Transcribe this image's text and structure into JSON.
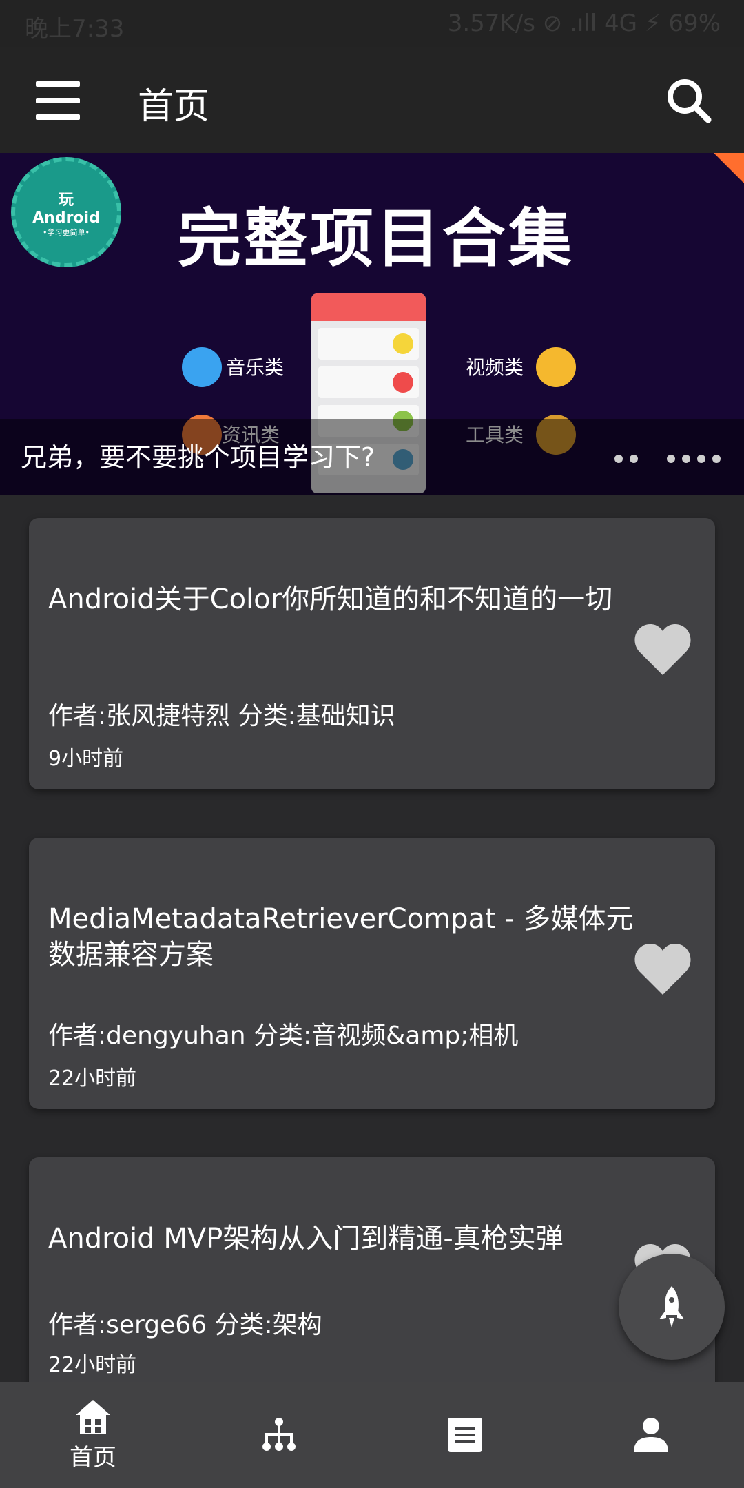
{
  "status_bar": {
    "time": "晚上7:33",
    "net_info": "3.57K/s ⊘ .ıll 4G ⚡ 69%"
  },
  "toolbar": {
    "title": "首页",
    "menu_icon": "menu-icon",
    "search_icon": "search-icon"
  },
  "banner": {
    "badge_line1": "玩",
    "badge_line2": "Android",
    "badge_line3": "•学习更简单•",
    "title": "完整项目合集",
    "categories": [
      "音乐类",
      "视频类",
      "资讯类",
      "工具类"
    ],
    "caption": "兄弟，要不要挑个项目学习下?"
  },
  "articles": [
    {
      "title": "Android关于Color你所知道的和不知道的一切",
      "meta": "作者:张风捷特烈  分类:基础知识",
      "time": "9小时前"
    },
    {
      "title": "MediaMetadataRetrieverCompat - 多媒体元数据兼容方案",
      "meta": "作者:dengyuhan  分类:音视频&amp;相机",
      "time": "22小时前"
    },
    {
      "title": "Android MVP架构从入门到精通-真枪实弹",
      "meta": "作者:serge66  分类:架构",
      "time": "22小时前"
    }
  ],
  "bottom_nav": {
    "home_label": "首页"
  },
  "colors": {
    "background": "#29292b",
    "card": "#414144",
    "toolbar": "#242424",
    "nav": "#424244"
  }
}
